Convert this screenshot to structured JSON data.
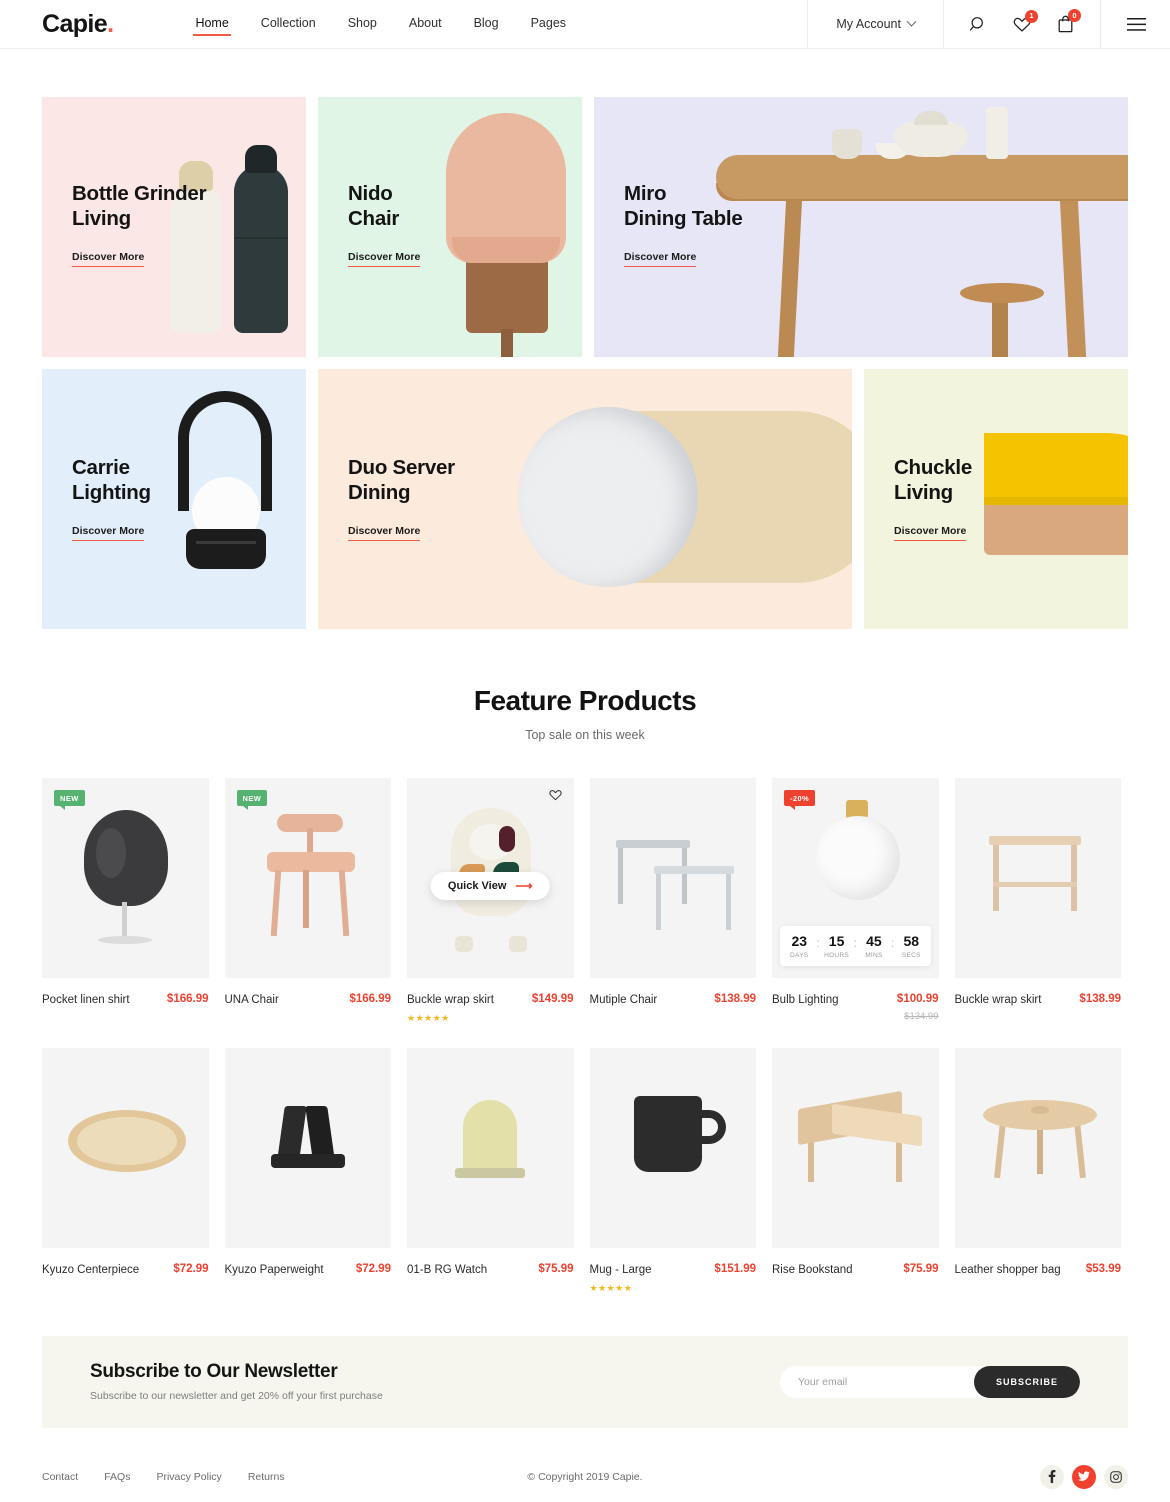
{
  "header": {
    "logo": "Capie",
    "logo_dot": ".",
    "nav": [
      {
        "label": "Home",
        "active": true
      },
      {
        "label": "Collection",
        "active": false
      },
      {
        "label": "Shop",
        "active": false
      },
      {
        "label": "About",
        "active": false
      },
      {
        "label": "Blog",
        "active": false
      },
      {
        "label": "Pages",
        "active": false
      }
    ],
    "account_label": "My Account",
    "icons": {
      "search": "search-icon",
      "wishlist": "heart-icon",
      "cart": "bag-icon",
      "menu": "hamburger-icon"
    },
    "wishlist_count": "1",
    "cart_count": "0"
  },
  "hero": {
    "discover_label": "Discover More",
    "banners": [
      {
        "title": "Bottle Grinder\nLiving",
        "color": "#fbe7e6"
      },
      {
        "title": "Nido\nChair",
        "color": "#e0f5e6"
      },
      {
        "title": "Miro\nDining Table",
        "color": "#e6e6f7"
      },
      {
        "title": "Carrie\nLighting",
        "color": "#e2effb"
      },
      {
        "title": "Duo Server\nDining",
        "color": "#fceadc"
      },
      {
        "title": "Chuckle\nLiving",
        "color": "#f3f4dd"
      }
    ]
  },
  "feature": {
    "title": "Feature Products",
    "subtitle": "Top sale on this week",
    "quick_view_label": "Quick View",
    "countdown": {
      "days": "23",
      "days_label": "DAYS",
      "hours": "15",
      "hours_label": "HOURS",
      "mins": "45",
      "mins_label": "MINS",
      "secs": "58",
      "secs_label": "SECS"
    },
    "products_row1": [
      {
        "name": "Pocket linen shirt",
        "price": "$166.99",
        "old_price": "",
        "tag": "NEW",
        "tag_type": "new",
        "stars": ""
      },
      {
        "name": "UNA Chair",
        "price": "$166.99",
        "old_price": "",
        "tag": "NEW",
        "tag_type": "new",
        "stars": ""
      },
      {
        "name": "Buckle wrap skirt",
        "price": "$149.99",
        "old_price": "",
        "tag": "",
        "tag_type": "",
        "stars": "★★★★★"
      },
      {
        "name": "Mutiple Chair",
        "price": "$138.99",
        "old_price": "",
        "tag": "",
        "tag_type": "",
        "stars": ""
      },
      {
        "name": "Bulb Lighting",
        "price": "$100.99",
        "old_price": "$134.99",
        "tag": "-20%",
        "tag_type": "sale",
        "stars": ""
      },
      {
        "name": "Buckle wrap skirt",
        "price": "$138.99",
        "old_price": "",
        "tag": "",
        "tag_type": "",
        "stars": ""
      }
    ],
    "products_row2": [
      {
        "name": "Kyuzo Centerpiece",
        "price": "$72.99",
        "old_price": "",
        "tag": "",
        "tag_type": "",
        "stars": ""
      },
      {
        "name": "Kyuzo Paperweight",
        "price": "$72.99",
        "old_price": "",
        "tag": "",
        "tag_type": "",
        "stars": ""
      },
      {
        "name": "01-B RG Watch",
        "price": "$75.99",
        "old_price": "",
        "tag": "",
        "tag_type": "",
        "stars": ""
      },
      {
        "name": "Mug - Large",
        "price": "$151.99",
        "old_price": "",
        "tag": "",
        "tag_type": "",
        "stars": "★★★★★"
      },
      {
        "name": "Rise Bookstand",
        "price": "$75.99",
        "old_price": "",
        "tag": "",
        "tag_type": "",
        "stars": ""
      },
      {
        "name": "Leather shopper bag",
        "price": "$53.99",
        "old_price": "",
        "tag": "",
        "tag_type": "",
        "stars": ""
      }
    ]
  },
  "newsletter": {
    "title": "Subscribe to Our Newsletter",
    "subtitle": "Subscribe to our newsletter and get 20% off your first purchase",
    "placeholder": "Your email",
    "input_value": "",
    "button_label": "SUBSCRIBE"
  },
  "footer": {
    "links": [
      "Contact",
      "FAQs",
      "Privacy Policy",
      "Returns"
    ],
    "copyright": "© Copyright 2019 Capie.",
    "socials": [
      "facebook-icon",
      "twitter-icon",
      "instagram-icon"
    ]
  },
  "colors": {
    "accent": "#f15a45",
    "price": "#f0402e",
    "new_badge": "#56b271",
    "star": "#f6b71a"
  }
}
